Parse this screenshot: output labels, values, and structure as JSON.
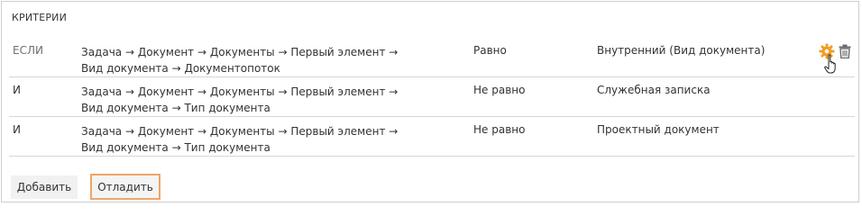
{
  "panel": {
    "title": "КРИТЕРИИ"
  },
  "rows": [
    {
      "keyword": "ЕСЛИ",
      "path_line1": "Задача → Документ → Документы → Первый элемент →",
      "path_line2": "Вид документа → Документопоток",
      "operator": "Равно",
      "value": "Внутренний (Вид документа)"
    },
    {
      "keyword": "И",
      "path_line1": "Задача → Документ → Документы → Первый элемент →",
      "path_line2": "Вид документа → Тип документа",
      "operator": "Не равно",
      "value": "Служебная записка"
    },
    {
      "keyword": "И",
      "path_line1": "Задача → Документ → Документы → Первый элемент →",
      "path_line2": "Вид документа → Тип документа",
      "operator": "Не равно",
      "value": "Проектный документ"
    }
  ],
  "buttons": {
    "add_label": "Добавить",
    "debug_label": "Отладить"
  },
  "icons": {
    "row_settings": "gear-icon",
    "row_delete": "trash-icon",
    "pointer": "hand-pointer-icon"
  },
  "colors": {
    "accent": "#f0a668",
    "gear": "#f59b21",
    "border": "#cfcfcf"
  }
}
